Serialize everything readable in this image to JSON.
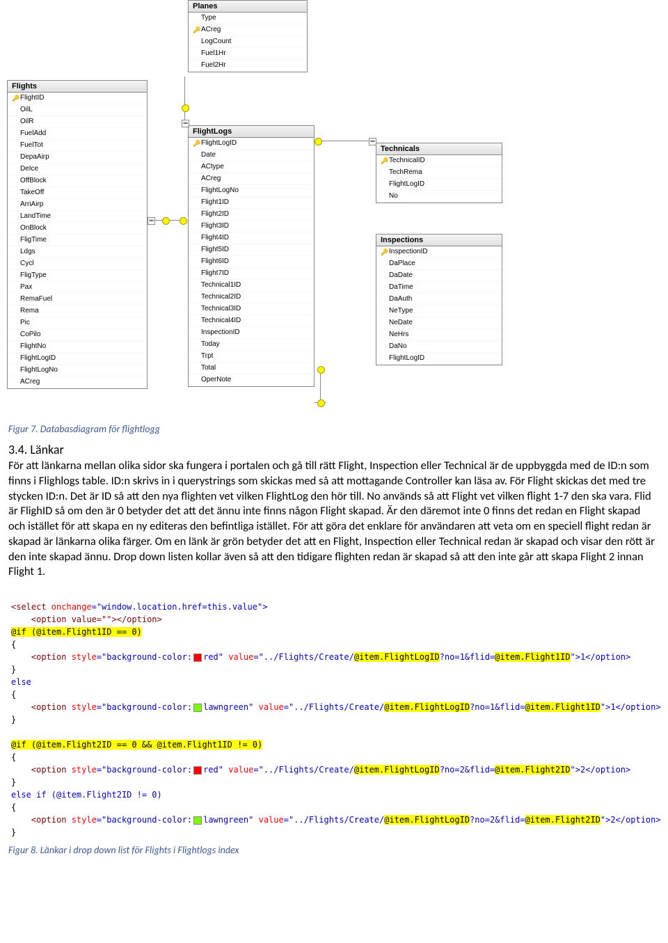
{
  "tables": {
    "planes": {
      "title": "Planes",
      "fields": [
        "Type",
        "ACreg",
        "LogCount",
        "Fuel1Hr",
        "Fuel2Hr"
      ],
      "key_index": 1
    },
    "flights": {
      "title": "Flights",
      "fields": [
        "FlightID",
        "OilL",
        "OilR",
        "FuelAdd",
        "FuelTot",
        "DepaAirp",
        "DeIce",
        "OffBlock",
        "TakeOff",
        "ArriAirp",
        "LandTime",
        "OnBlock",
        "FligTime",
        "Ldgs",
        "Cycl",
        "FligType",
        "Pax",
        "RemaFuel",
        "Rema",
        "Pic",
        "CoPilo",
        "FlightNo",
        "FlightLogID",
        "FlightLogNo",
        "ACreg"
      ],
      "key_index": 0
    },
    "flightlogs": {
      "title": "FlightLogs",
      "fields": [
        "FlightLogID",
        "Date",
        "ACtype",
        "ACreg",
        "FlightLogNo",
        "Flight1ID",
        "Flight2ID",
        "Flight3ID",
        "Flight4ID",
        "Flight5ID",
        "Flight6ID",
        "Flight7ID",
        "Technical1ID",
        "Technical2ID",
        "Technical3ID",
        "Technical4ID",
        "InspectionID",
        "Today",
        "Trpt",
        "Total",
        "OperNote"
      ],
      "key_index": 0
    },
    "technicals": {
      "title": "Technicals",
      "fields": [
        "TechnicalID",
        "TechRema",
        "FlightLogID",
        "No"
      ],
      "key_index": 0
    },
    "inspections": {
      "title": "Inspections",
      "fields": [
        "InspectionID",
        "DaPlace",
        "DaDate",
        "DaTime",
        "DaAuth",
        "NeType",
        "NeDate",
        "NeHrs",
        "DaNo",
        "FlightLogID"
      ],
      "key_index": 0
    }
  },
  "captions": {
    "fig7": "Figur 7. Databasdiagram för flightlogg",
    "fig8": "Figur 8. Länkar i drop down list för Flights i Flightlogs index"
  },
  "section": {
    "num": "3.4. Länkar"
  },
  "paragraph": "För att länkarna mellan olika sidor ska fungera i portalen och gå till rätt Flight, Inspection eller Technical är de uppbyggda med de ID:n som finns i Flighlogs table. ID:n skrivs in i querystrings som skickas med så att mottagande Controller kan läsa av. För Flight skickas det med tre stycken ID:n. Det är ID så att den nya flighten vet vilken FlightLog den hör till. No används så att Flight vet vilken flight 1-7 den ska vara. Flid är FlighID så om den är 0 betyder det att det ännu inte finns någon Flight skapad. Är den däremot inte 0 finns det redan en Flight skapad och istället för att skapa en ny editeras den befintliga istället. För att göra det enklare för användaren att veta om en speciell flight redan är skapad är länkarna olika färger. Om en länk är grön betyder det att en Flight, Inspection eller Technical redan är skapad och visar den rött är den inte skapad ännu. Drop down listen kollar även så att den tidigare flighten redan är skapad så att den inte går att skapa Flight 2 innan Flight 1.",
  "code": {
    "line1_a": "<select ",
    "line1_b": "onchange",
    "line1_c": "=\"window.location.href=this.value\">",
    "line2": "    <option value=\"\"></option>",
    "line3_a": "@if (@item.Flight1ID == 0)",
    "line4": "{",
    "line5_a": "    <option ",
    "line5_b": "style",
    "line5_c": "=\"background-color:",
    "line5_d": "red\" ",
    "line5_e": "value",
    "line5_f": "=\"../Flights/Create/",
    "line5_g": "@item.FlightLogID",
    "line5_h": "?no=1&flid=",
    "line5_i": "@item.Flight1ID",
    "line5_j": "\">1</option>",
    "line6": "}",
    "line7": "else",
    "line8": "{",
    "line9_a": "    <option ",
    "line9_b": "style",
    "line9_c": "=\"background-color:",
    "line9_d": "lawngreen\" ",
    "line9_e": "value",
    "line9_f": "=\"../Flights/Create/",
    "line9_g": "@item.FlightLogID",
    "line9_h": "?no=1&flid=",
    "line9_i": "@item.Flight1ID",
    "line9_j": "\">1</option>",
    "line10": "}",
    "blank": "",
    "line11_a": "@if (@item.Flight2ID == 0 && @item.Flight1ID != 0)",
    "line12": "{",
    "line13_a": "    <option ",
    "line13_b": "style",
    "line13_c": "=\"background-color:",
    "line13_d": "red\" ",
    "line13_e": "value",
    "line13_f": "=\"../Flights/Create/",
    "line13_g": "@item.FlightLogID",
    "line13_h": "?no=2&flid=",
    "line13_i": "@item.Flight2ID",
    "line13_j": "\">2</option>",
    "line14": "}",
    "line15": "else if (@item.Flight2ID != 0)",
    "line16": "{",
    "line17_a": "    <option ",
    "line17_b": "style",
    "line17_c": "=\"background-color:",
    "line17_d": "lawngreen\" ",
    "line17_e": "value",
    "line17_f": "=\"../Flights/Create/",
    "line17_g": "@item.FlightLogID",
    "line17_h": "?no=2&flid=",
    "line17_i": "@item.Flight2ID",
    "line17_j": "\">2</option>",
    "line18": "}"
  }
}
